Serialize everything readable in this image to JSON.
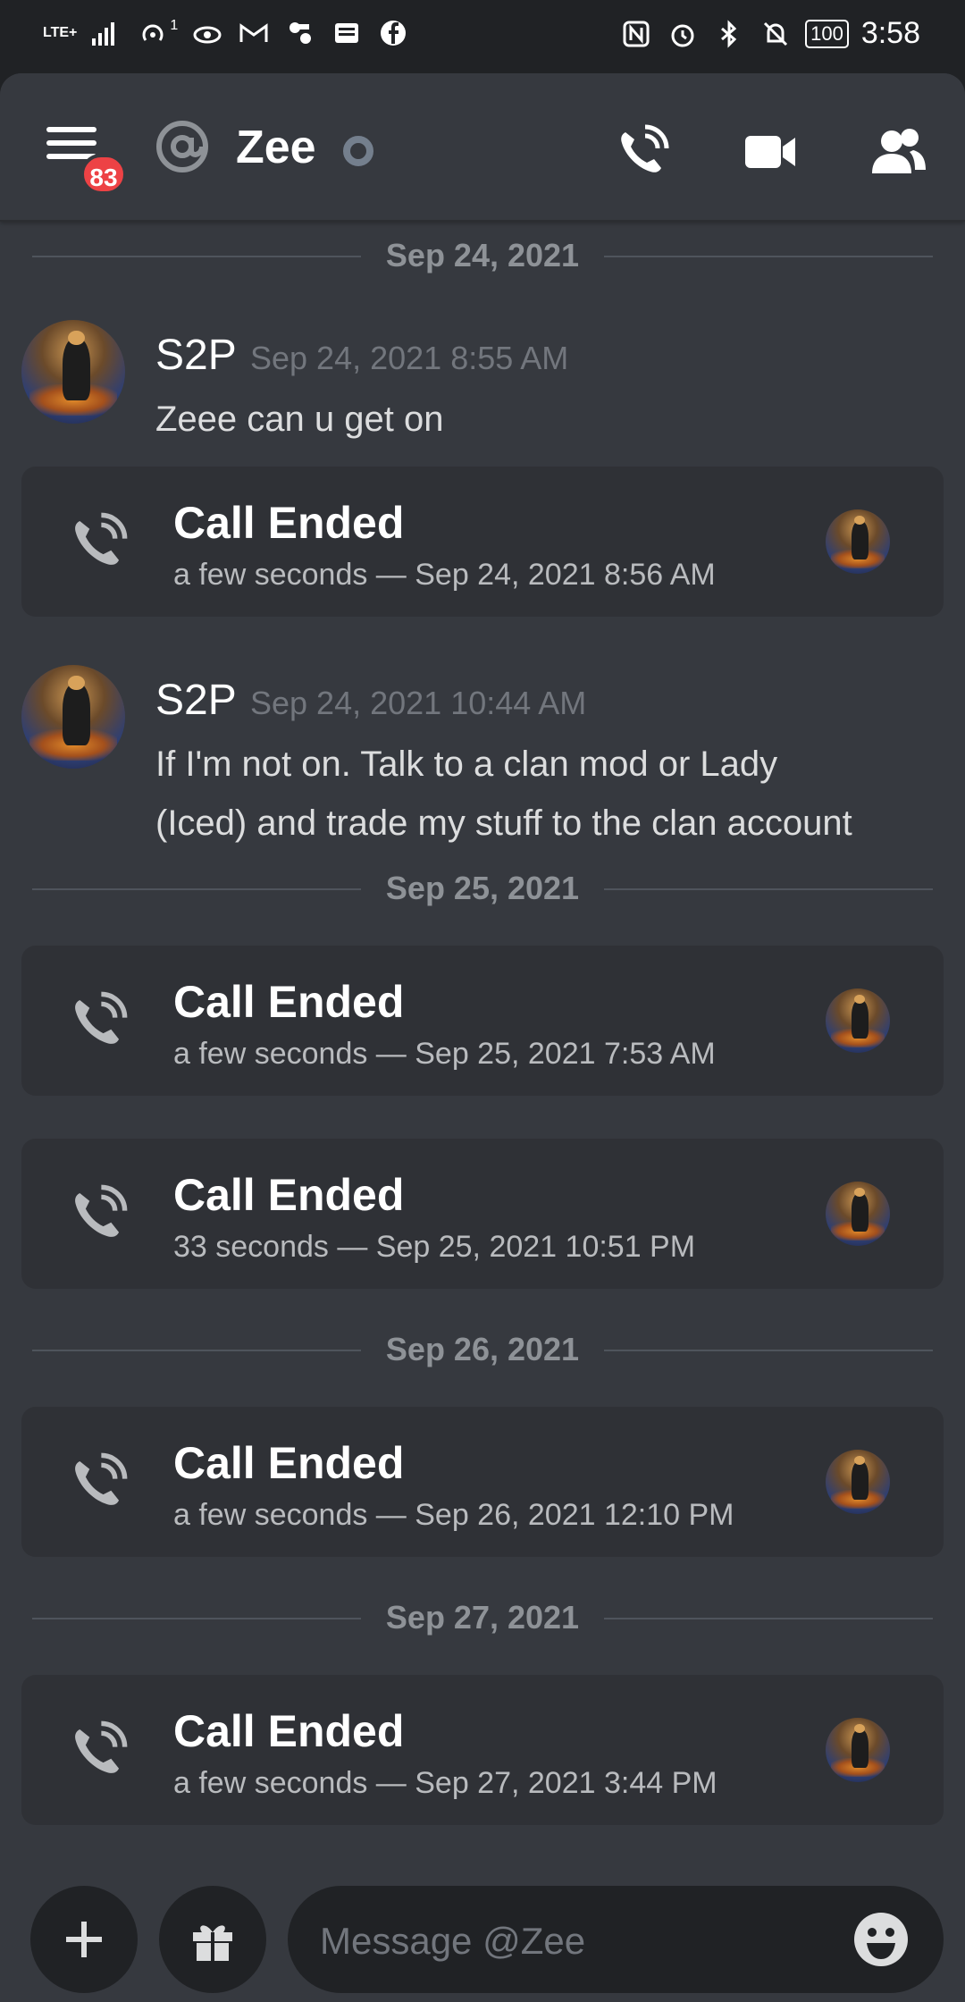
{
  "status_bar": {
    "network": "LTE+",
    "signal_label": "1",
    "battery": "100",
    "time": "3:58"
  },
  "header": {
    "unread_badge": "83",
    "title": "Zee"
  },
  "messages": [
    {
      "type": "divider",
      "label": "Sep 24, 2021"
    },
    {
      "type": "message",
      "author": "S2P",
      "time": "Sep 24, 2021 8:55 AM",
      "lines": [
        "Zeee can u get on"
      ]
    },
    {
      "type": "call",
      "title": "Call Ended",
      "subtitle": "a few seconds — Sep 24, 2021 8:56 AM"
    },
    {
      "type": "message",
      "author": "S2P",
      "time": "Sep 24, 2021 10:44 AM",
      "lines": [
        "If I'm not on. Talk to a clan mod or Lady",
        "(Iced) and trade my stuff to the clan account"
      ]
    },
    {
      "type": "divider",
      "label": "Sep 25, 2021"
    },
    {
      "type": "call",
      "title": "Call Ended",
      "subtitle": "a few seconds — Sep 25, 2021 7:53 AM"
    },
    {
      "type": "call",
      "title": "Call Ended",
      "subtitle": "33 seconds — Sep 25, 2021 10:51 PM"
    },
    {
      "type": "divider",
      "label": "Sep 26, 2021"
    },
    {
      "type": "call",
      "title": "Call Ended",
      "subtitle": "a few seconds — Sep 26, 2021 12:10 PM"
    },
    {
      "type": "divider",
      "label": "Sep 27, 2021"
    },
    {
      "type": "call",
      "title": "Call Ended",
      "subtitle": "a few seconds — Sep 27, 2021 3:44 PM"
    }
  ],
  "composer": {
    "placeholder": "Message @Zee"
  },
  "colors": {
    "background": "#36393f",
    "card": "#2f3136",
    "badge": "#ed4245",
    "muted": "#72767d"
  }
}
